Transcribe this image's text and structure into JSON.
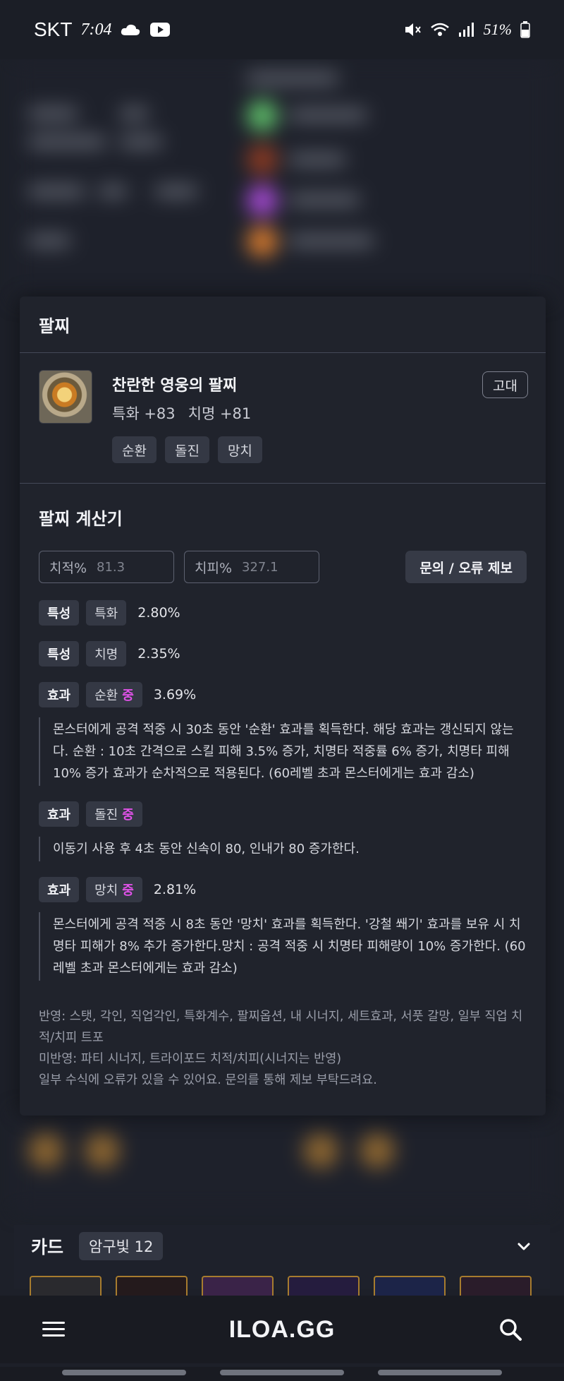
{
  "status_bar": {
    "carrier": "SKT",
    "time": "7:04",
    "battery": "51%"
  },
  "bracelet": {
    "title": "팔찌",
    "item_name": "찬란한 영웅의 팔찌",
    "stats": [
      "특화 +83",
      "치명 +81"
    ],
    "effect_tags": [
      "순환",
      "돌진",
      "망치"
    ],
    "grade": "고대"
  },
  "calculator": {
    "title": "팔찌 계산기",
    "crit_rate_label": "치적%",
    "crit_rate_value": "81.3",
    "crit_dmg_label": "치피%",
    "crit_dmg_value": "327.1",
    "report_button": "문의 / 오류 제보",
    "traits": [
      {
        "type": "특성",
        "name": "특화",
        "tier": "",
        "value": "2.80%",
        "desc": ""
      },
      {
        "type": "특성",
        "name": "치명",
        "tier": "",
        "value": "2.35%",
        "desc": ""
      },
      {
        "type": "효과",
        "name": "순환",
        "tier": "중",
        "value": "3.69%",
        "desc": "몬스터에게 공격 적중 시 30초 동안 '순환' 효과를 획득한다. 해당 효과는 갱신되지 않는다. 순환 : 10초 간격으로 스킬 피해 3.5% 증가, 치명타 적중률 6% 증가, 치명타 피해 10% 증가 효과가 순차적으로 적용된다. (60레벨 초과 몬스터에게는 효과 감소)"
      },
      {
        "type": "효과",
        "name": "돌진",
        "tier": "중",
        "value": "",
        "desc": "이동기 사용 후 4초 동안 신속이 80, 인내가 80 증가한다."
      },
      {
        "type": "효과",
        "name": "망치",
        "tier": "중",
        "value": "2.81%",
        "desc": "몬스터에게 공격 적중 시 8초 동안 '망치' 효과를 획득한다. '강철 쐐기' 효과를 보유 시 치명타 피해가 8% 추가 증가한다.망치 : 공격 적중 시 치명타 피해량이 10% 증가한다. (60레벨 초과 몬스터에게는 효과 감소)"
      }
    ],
    "notes": [
      "반영: 스탯, 각인, 직업각인, 특화계수, 팔찌옵션, 내 시너지, 세트효과, 서풋 갈망, 일부 직업 치적/치피 트포",
      "미반영: 파티 시너지, 트라이포드 치적/치피(시너지는 반영)",
      "일부 수식에 오류가 있을 수 있어요. 문의를 통해 제보 부탁드려요."
    ]
  },
  "cards": {
    "title": "카드",
    "set_name": "암구빛 12"
  },
  "bottom_nav": {
    "logo": "ILOA.GG"
  },
  "colors": {
    "background": "#1d2029",
    "panel": "#20232c",
    "chip": "#343844",
    "tier_accent": "#e052e8"
  }
}
